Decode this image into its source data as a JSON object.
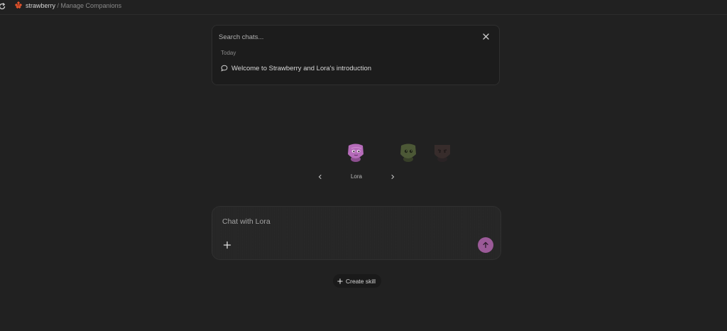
{
  "header": {
    "brand": "strawberry",
    "separator": " / ",
    "page": "Manage Companions",
    "refresh_icon": "refresh-icon",
    "logo_icon": "strawberry-logo-icon"
  },
  "search": {
    "placeholder": "Search chats...",
    "value": "",
    "close_icon": "close-icon",
    "group_label": "Today",
    "results": [
      {
        "title": "Welcome to Strawberry and Lora's introduction",
        "icon": "chat-bubble-icon"
      }
    ]
  },
  "companions": {
    "selected_name": "Lora",
    "items": [
      {
        "icon": "lora-avatar-icon",
        "color": "#b56bb9",
        "selected": true
      },
      {
        "icon": "green-companion-avatar-icon",
        "color": "#5b6b3d",
        "selected": false
      },
      {
        "icon": "dark-companion-avatar-icon",
        "color": "#4a3534",
        "selected": false
      }
    ],
    "prev_icon": "chevron-left-icon",
    "next_icon": "chevron-right-icon"
  },
  "composer": {
    "placeholder": "Chat with Lora",
    "value": "",
    "attach_icon": "plus-icon",
    "send_icon": "arrow-up-icon",
    "send_color": "#9b5a98"
  },
  "actions": {
    "create_skill_label": "Create skill",
    "create_skill_icon": "plus-icon"
  },
  "colors": {
    "background": "#212121",
    "panel": "#1c1c1c",
    "accent": "#9b5a98",
    "brand": "#e2552d"
  }
}
